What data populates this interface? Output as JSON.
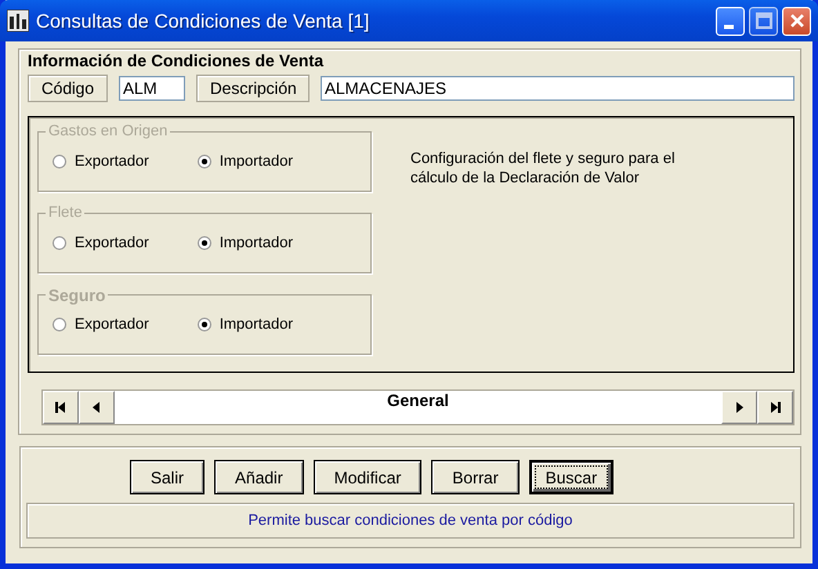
{
  "window": {
    "title": "Consultas de Condiciones de Venta [1]"
  },
  "info": {
    "title": "Información de Condiciones de Venta",
    "fields": [
      {
        "label": "Código",
        "value": "ALM"
      },
      {
        "label": "Descripción",
        "value": "ALMACENAJES"
      }
    ]
  },
  "groups": [
    {
      "legend": "Gastos en Origen",
      "bold": false,
      "disabled": true,
      "options": [
        {
          "label": "Exportador",
          "selected": false
        },
        {
          "label": "Importador",
          "selected": true
        }
      ]
    },
    {
      "legend": "Flete",
      "bold": false,
      "disabled": true,
      "options": [
        {
          "label": "Exportador",
          "selected": false
        },
        {
          "label": "Importador",
          "selected": true
        }
      ]
    },
    {
      "legend": "Seguro",
      "bold": true,
      "disabled": true,
      "options": [
        {
          "label": "Exportador",
          "selected": false
        },
        {
          "label": "Importador",
          "selected": true
        }
      ]
    }
  ],
  "description": "Configuración del flete y seguro para el cálculo de la Declaración de Valor",
  "navigator": {
    "label": "General"
  },
  "buttons": [
    {
      "label": "Salir",
      "focused": false
    },
    {
      "label": "Añadir",
      "focused": false
    },
    {
      "label": "Modificar",
      "focused": false
    },
    {
      "label": "Borrar",
      "focused": false
    },
    {
      "label": "Buscar",
      "focused": true
    }
  ],
  "status_bar": "Permite buscar condiciones de venta por código"
}
